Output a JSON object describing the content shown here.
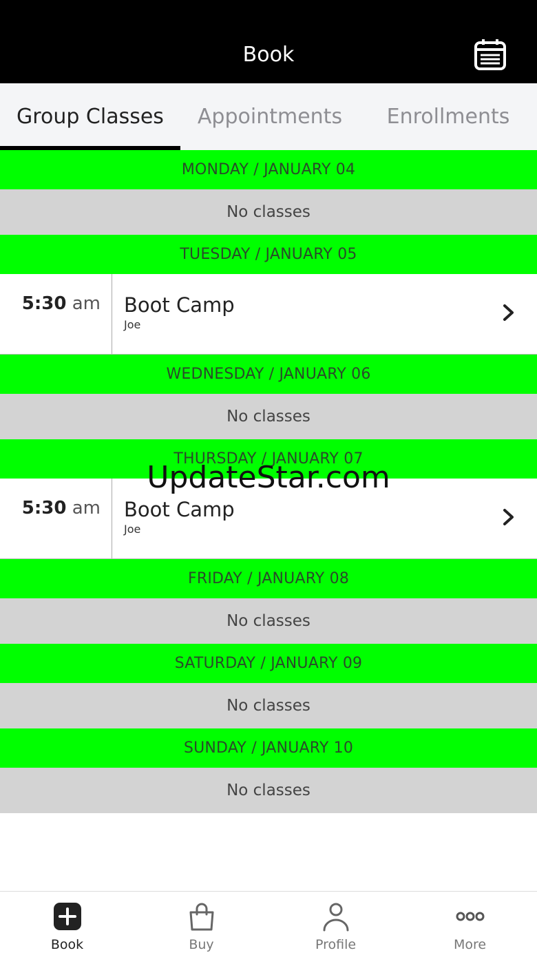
{
  "header": {
    "title": "Book",
    "calendar_icon": "calendar-icon"
  },
  "tabs": [
    {
      "label": "Group Classes",
      "active": true
    },
    {
      "label": "Appointments",
      "active": false
    },
    {
      "label": "Enrollments",
      "active": false
    }
  ],
  "days": [
    {
      "header": "MONDAY / JANUARY 04",
      "empty_text": "No classes"
    },
    {
      "header": "TUESDAY / JANUARY 05",
      "class": {
        "time": "5:30",
        "ampm": "am",
        "name": "Boot Camp",
        "instructor": "Joe"
      }
    },
    {
      "header": "WEDNESDAY / JANUARY 06",
      "empty_text": "No classes"
    },
    {
      "header": "THURSDAY / JANUARY 07",
      "class": {
        "time": "5:30",
        "ampm": "am",
        "name": "Boot Camp",
        "instructor": "Joe"
      }
    },
    {
      "header": "FRIDAY / JANUARY 08",
      "empty_text": "No classes"
    },
    {
      "header": "SATURDAY / JANUARY 09",
      "empty_text": "No classes"
    },
    {
      "header": "SUNDAY / JANUARY 10",
      "empty_text": "No classes"
    }
  ],
  "watermark": "UpdateStar.com",
  "bottom_nav": [
    {
      "label": "Book",
      "icon": "plus-square-icon",
      "active": true
    },
    {
      "label": "Buy",
      "icon": "shopping-bag-icon",
      "active": false
    },
    {
      "label": "Profile",
      "icon": "person-icon",
      "active": false
    },
    {
      "label": "More",
      "icon": "more-dots-icon",
      "active": false
    }
  ],
  "colors": {
    "day_header": "#00ff00",
    "no_classes_bg": "#d3d3d3",
    "header_bg": "#000000"
  }
}
